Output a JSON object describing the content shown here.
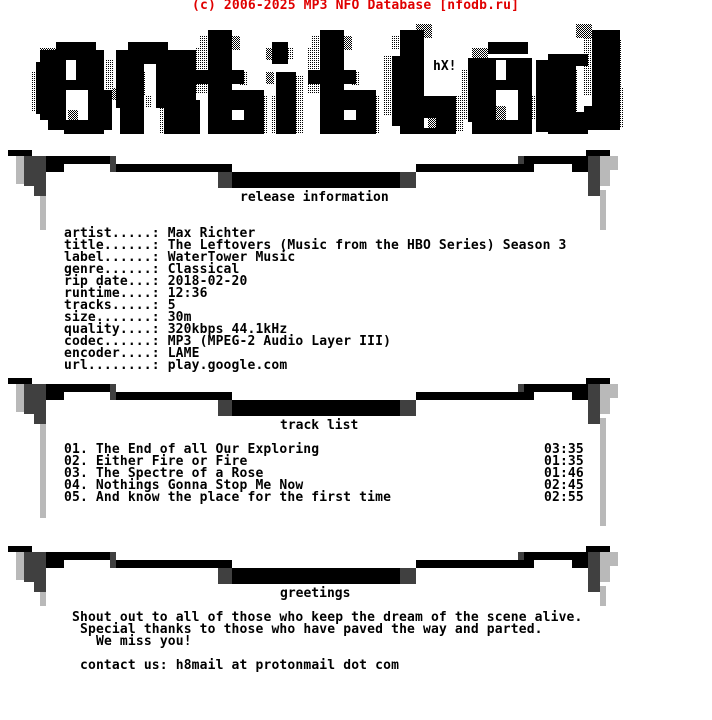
{
  "header": {
    "copyright": "(c) 2006-2025 MP3 NFO Database [nfodb.ru]",
    "color": "#e00000"
  },
  "logo": {
    "text": "entitled",
    "tag": "hX!"
  },
  "release_info": {
    "title": "release information",
    "fields": [
      {
        "label": "artist.....:",
        "value": "Max Richter"
      },
      {
        "label": "title......:",
        "value": "The Leftovers (Music from the HBO Series) Season 3"
      },
      {
        "label": "label......:",
        "value": "WaterTower Music"
      },
      {
        "label": "genre......:",
        "value": "Classical"
      },
      {
        "label": "rip date...:",
        "value": "2018-02-20"
      },
      {
        "label": "runtime....:",
        "value": "12:36"
      },
      {
        "label": "tracks.....:",
        "value": "5"
      },
      {
        "label": "size.......:",
        "value": "30m"
      },
      {
        "label": "quality....:",
        "value": "320kbps 44.1kHz"
      },
      {
        "label": "codec......:",
        "value": "MP3 (MPEG-2 Audio Layer III)"
      },
      {
        "label": "encoder....:",
        "value": "LAME"
      },
      {
        "label": "url........:",
        "value": "play.google.com"
      }
    ]
  },
  "track_list": {
    "title": "track list",
    "tracks": [
      {
        "num": "01.",
        "name": "The End of all Our Exploring",
        "duration": "03:35"
      },
      {
        "num": "02.",
        "name": "Either Fire or Fire",
        "duration": "01:35"
      },
      {
        "num": "03.",
        "name": "The Spectre of a Rose",
        "duration": "01:46"
      },
      {
        "num": "04.",
        "name": "Nothings Gonna Stop Me Now",
        "duration": "02:45"
      },
      {
        "num": "05.",
        "name": "And know the place for the first time",
        "duration": "02:55"
      }
    ]
  },
  "greetings": {
    "title": "greetings",
    "lines": [
      "Shout out to all of those who keep the dream of the scene alive.",
      "Special thanks to those who have paved the way and parted.",
      "We miss you!"
    ],
    "contact": "contact us: h8mail at protonmail dot com"
  }
}
